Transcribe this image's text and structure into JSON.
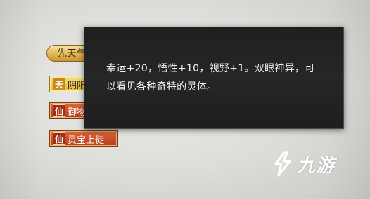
{
  "traits": [
    {
      "icon": "",
      "label": "先天气运"
    },
    {
      "icon": "天",
      "label": "阴阳眼"
    },
    {
      "icon": "仙",
      "label": "御物如神"
    },
    {
      "icon": "仙",
      "label": "灵宝上徒"
    }
  ],
  "tooltip": {
    "text": "幸运+20，悟性+10，视野+1。双眼神异，可以看见各种奇特的灵体。"
  },
  "watermark": {
    "text": "九游"
  },
  "colors": {
    "gold_tag": "#e2b654",
    "red_tag": "#c24a25",
    "yellow_tag": "#e9c24e",
    "tooltip_bg": "#222222"
  }
}
